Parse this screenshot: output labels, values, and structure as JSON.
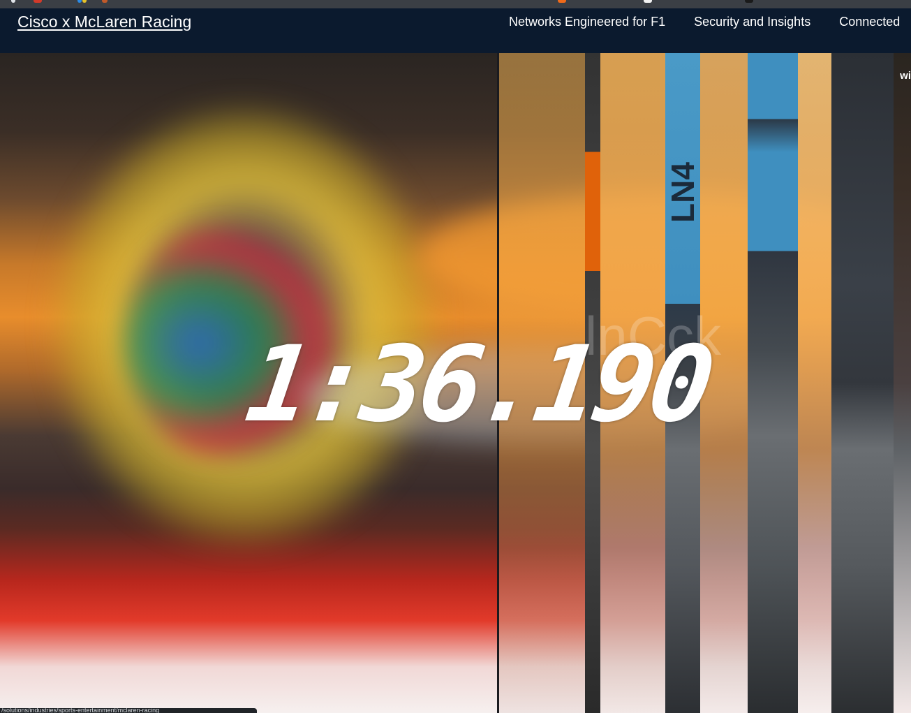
{
  "header": {
    "brand": "Cisco x McLaren Racing",
    "nav": [
      "Networks Engineered for F1",
      "Security and Insights",
      "Connected"
    ]
  },
  "hero": {
    "lap_time": "1:36.190",
    "ghost_text": "lnCck",
    "corner_text": "wi",
    "livery_text": "LN4"
  },
  "status_bar": {
    "url": "/solutions/industries/sports-entertainment/mclaren-racing"
  },
  "colors": {
    "header_bg": "#0b1a2e",
    "papaya": "#e88d2c",
    "red": "#e23a2a",
    "blue_panel": "#3f8fbf"
  }
}
